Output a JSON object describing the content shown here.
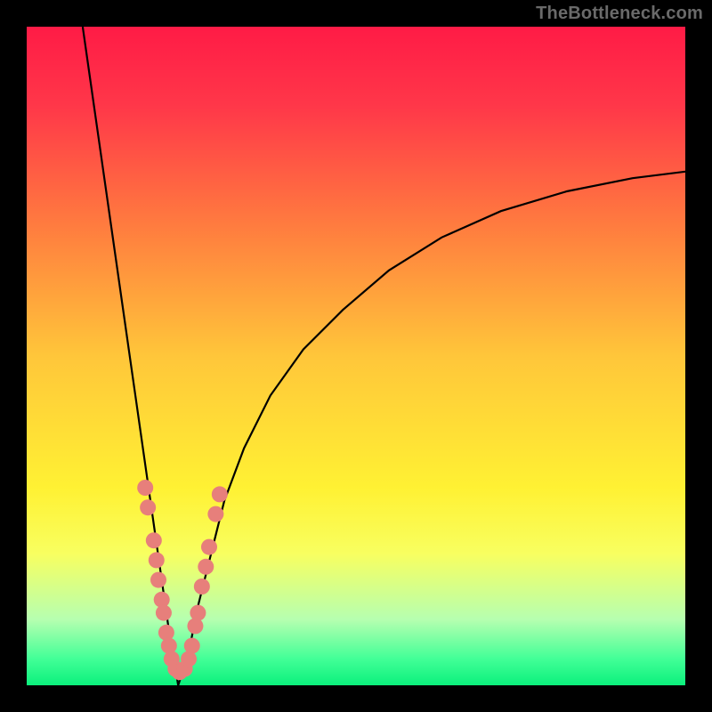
{
  "watermark": "TheBottleneck.com",
  "chart_data": {
    "type": "line",
    "title": "",
    "xlabel": "",
    "ylabel": "",
    "x_range": [
      0,
      100
    ],
    "y_range": [
      0,
      100
    ],
    "notch_x": 23,
    "gradient_stops": [
      {
        "offset": 0,
        "color": "#ff1b46"
      },
      {
        "offset": 12,
        "color": "#ff3749"
      },
      {
        "offset": 30,
        "color": "#ff7b3f"
      },
      {
        "offset": 50,
        "color": "#ffc63a"
      },
      {
        "offset": 70,
        "color": "#fff133"
      },
      {
        "offset": 80,
        "color": "#f8ff60"
      },
      {
        "offset": 90,
        "color": "#b6ffb0"
      },
      {
        "offset": 96,
        "color": "#42ff97"
      },
      {
        "offset": 100,
        "color": "#0bf07c"
      }
    ],
    "series": [
      {
        "name": "left_arm",
        "x": [
          8.5,
          9.5,
          10.5,
          11.5,
          12.5,
          13.5,
          14.5,
          15.5,
          16.5,
          17.5,
          18.5,
          19.5,
          20.5,
          21.5,
          22.5,
          23.0
        ],
        "y": [
          100,
          93,
          86,
          79,
          72,
          65,
          58,
          51,
          44,
          37,
          30,
          23,
          16,
          9,
          3,
          0
        ]
      },
      {
        "name": "right_arm",
        "x": [
          23,
          24,
          25,
          26,
          28,
          30,
          33,
          37,
          42,
          48,
          55,
          63,
          72,
          82,
          92,
          100
        ],
        "y": [
          0,
          3,
          7,
          12,
          20,
          28,
          36,
          44,
          51,
          57,
          63,
          68,
          72,
          75,
          77,
          78
        ]
      }
    ],
    "markers": {
      "color": "#e77f7b",
      "radius": 9,
      "points": [
        {
          "x": 18.0,
          "y": 30
        },
        {
          "x": 18.4,
          "y": 27
        },
        {
          "x": 19.3,
          "y": 22
        },
        {
          "x": 19.7,
          "y": 19
        },
        {
          "x": 20.0,
          "y": 16
        },
        {
          "x": 20.5,
          "y": 13
        },
        {
          "x": 20.8,
          "y": 11
        },
        {
          "x": 21.2,
          "y": 8
        },
        {
          "x": 21.6,
          "y": 6
        },
        {
          "x": 22.0,
          "y": 4
        },
        {
          "x": 22.6,
          "y": 2.5
        },
        {
          "x": 23.2,
          "y": 2.0
        },
        {
          "x": 24.0,
          "y": 2.5
        },
        {
          "x": 24.6,
          "y": 4
        },
        {
          "x": 25.1,
          "y": 6
        },
        {
          "x": 25.6,
          "y": 9
        },
        {
          "x": 26.0,
          "y": 11
        },
        {
          "x": 26.6,
          "y": 15
        },
        {
          "x": 27.2,
          "y": 18
        },
        {
          "x": 27.7,
          "y": 21
        },
        {
          "x": 28.7,
          "y": 26
        },
        {
          "x": 29.3,
          "y": 29
        }
      ]
    }
  }
}
